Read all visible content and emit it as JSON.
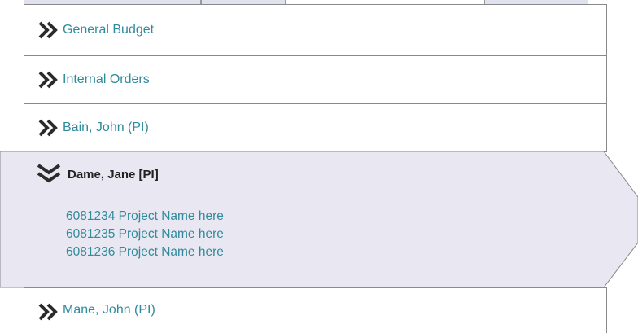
{
  "accordion": {
    "items": [
      {
        "label": "General Budget",
        "state": "collapsed",
        "icon": "double-chevron-right-icon"
      },
      {
        "label": "Internal Orders",
        "state": "collapsed",
        "icon": "double-chevron-right-icon"
      },
      {
        "label": "Bain, John  (PI)",
        "state": "collapsed",
        "icon": "double-chevron-right-icon"
      },
      {
        "label": "Dame, Jane [PI]",
        "state": "expanded",
        "icon": "double-chevron-down-icon",
        "projects": [
          "6081234 Project Name here",
          "6081235 Project Name here",
          "6081236 Project Name here"
        ]
      },
      {
        "label": "Mane, John  (PI)",
        "state": "collapsed",
        "icon": "double-chevron-right-icon"
      }
    ]
  },
  "colors": {
    "link": "#2f8a9b",
    "chevron": "#2b2b2b",
    "expanded_bg": "#e9e7f1",
    "border": "#8a8a8a",
    "top_tab_bg": "#dfe1ec"
  }
}
